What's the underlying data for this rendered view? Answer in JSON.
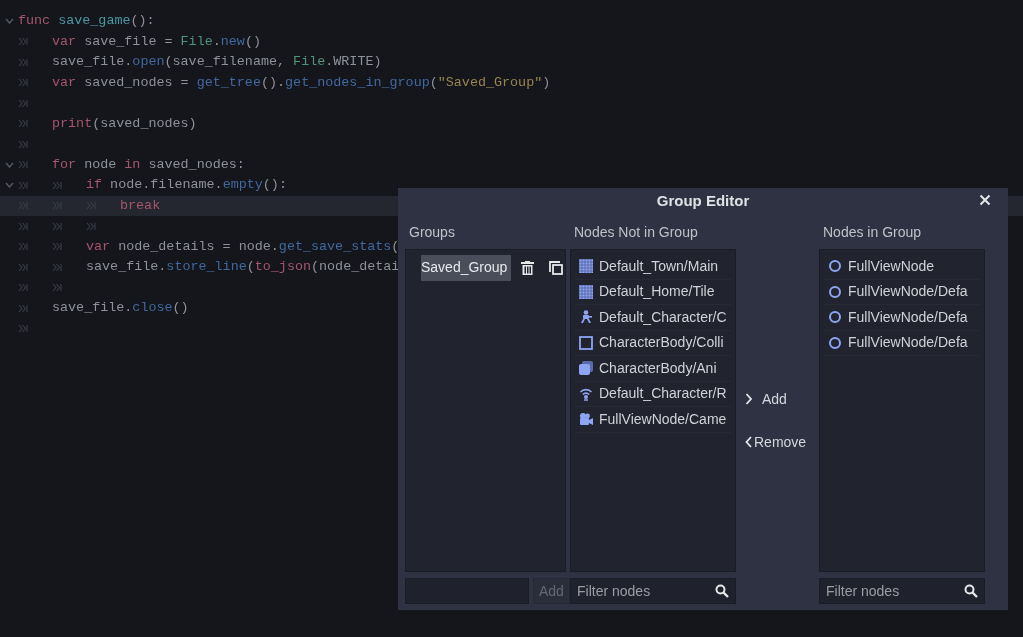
{
  "code_editor": {
    "lines": [
      {
        "foldable": true,
        "current": false,
        "tokens": [
          {
            "kind": "keyword",
            "text": "func"
          },
          {
            "kind": "name",
            "text": " save_game"
          },
          {
            "kind": "plain",
            "text": "():"
          }
        ],
        "children": [
          {
            "foldable": false,
            "current": false,
            "tokens": [
              {
                "kind": "keyword",
                "text": "var"
              },
              {
                "kind": "plain",
                "text": " save_file = "
              },
              {
                "kind": "class",
                "text": "File"
              },
              {
                "kind": "plain",
                "text": "."
              },
              {
                "kind": "method",
                "text": "new"
              },
              {
                "kind": "plain",
                "text": "()"
              }
            ]
          },
          {
            "foldable": false,
            "current": false,
            "tokens": [
              {
                "kind": "plain",
                "text": "save_file."
              },
              {
                "kind": "method",
                "text": "open"
              },
              {
                "kind": "plain",
                "text": "(save_filename, "
              },
              {
                "kind": "class",
                "text": "File"
              },
              {
                "kind": "plain",
                "text": ".WRITE)"
              }
            ]
          },
          {
            "foldable": false,
            "current": false,
            "tokens": [
              {
                "kind": "keyword",
                "text": "var"
              },
              {
                "kind": "plain",
                "text": " saved_nodes = "
              },
              {
                "kind": "method",
                "text": "get_tree"
              },
              {
                "kind": "plain",
                "text": "()."
              },
              {
                "kind": "method",
                "text": "get_nodes_in_group"
              },
              {
                "kind": "plain",
                "text": "("
              },
              {
                "kind": "string",
                "text": "\"Saved_Group\""
              },
              {
                "kind": "plain",
                "text": ")"
              }
            ]
          },
          {
            "foldable": false,
            "current": false
          },
          {
            "foldable": false,
            "current": false,
            "tokens": [
              {
                "kind": "keyword",
                "text": "print"
              },
              {
                "kind": "plain",
                "text": "(saved_nodes)"
              }
            ]
          },
          {
            "foldable": false,
            "current": false
          },
          {
            "foldable": true,
            "current": false,
            "tokens": [
              {
                "kind": "keyword",
                "text": "for"
              },
              {
                "kind": "plain",
                "text": " node "
              },
              {
                "kind": "keyword",
                "text": "in"
              },
              {
                "kind": "plain",
                "text": " saved_nodes:"
              }
            ],
            "children": [
              {
                "foldable": true,
                "current": false,
                "tokens": [
                  {
                    "kind": "keyword",
                    "text": "if"
                  },
                  {
                    "kind": "plain",
                    "text": " node.filename."
                  },
                  {
                    "kind": "method",
                    "text": "empty"
                  },
                  {
                    "kind": "plain",
                    "text": "():"
                  }
                ],
                "children": [
                  {
                    "foldable": false,
                    "current": true,
                    "tokens": [
                      {
                        "kind": "keyword",
                        "text": "break"
                      }
                    ]
                  },
                  {
                    "foldable": false,
                    "current": false
                  }
                ]
              },
              {
                "foldable": false,
                "current": false,
                "tokens": [
                  {
                    "kind": "keyword",
                    "text": "var"
                  },
                  {
                    "kind": "plain",
                    "text": " node_details = node."
                  },
                  {
                    "kind": "method",
                    "text": "get_save_stats"
                  },
                  {
                    "kind": "plain",
                    "text": "("
                  }
                ]
              },
              {
                "foldable": false,
                "current": false,
                "tokens": [
                  {
                    "kind": "plain",
                    "text": "save_file."
                  },
                  {
                    "kind": "method",
                    "text": "store_line"
                  },
                  {
                    "kind": "plain",
                    "text": "("
                  },
                  {
                    "kind": "keyword",
                    "text": "to_json"
                  },
                  {
                    "kind": "plain",
                    "text": "(node_detai"
                  }
                ]
              },
              {
                "foldable": false,
                "current": false
              }
            ]
          },
          {
            "foldable": false,
            "current": false,
            "tokens": [
              {
                "kind": "plain",
                "text": "save_file."
              },
              {
                "kind": "method",
                "text": "close"
              },
              {
                "kind": "plain",
                "text": "()"
              }
            ]
          },
          {
            "foldable": false,
            "current": false
          }
        ]
      }
    ]
  },
  "dialog": {
    "title": "Group Editor",
    "groups": {
      "label": "Groups",
      "items": [
        {
          "name": "Saved_Group",
          "selected": true
        }
      ],
      "add_button": {
        "label": "Add",
        "disabled": true
      }
    },
    "nodes_not_in_group": {
      "label": "Nodes Not in Group",
      "items": [
        {
          "kind": "tilemap",
          "text": "Default_Town/Main"
        },
        {
          "kind": "tilemap",
          "text": "Default_Home/Tile"
        },
        {
          "kind": "character",
          "text": "Default_Character/C"
        },
        {
          "kind": "collision",
          "text": "CharacterBody/Colli"
        },
        {
          "kind": "sprite",
          "text": "CharacterBody/Ani"
        },
        {
          "kind": "signal",
          "text": "Default_Character/R"
        },
        {
          "kind": "camera",
          "text": "FullViewNode/Came"
        }
      ],
      "filter": {
        "placeholder": "Filter nodes"
      }
    },
    "actions": [
      {
        "kind": "add",
        "label": "Add"
      },
      {
        "kind": "remove",
        "label": "Remove"
      }
    ],
    "nodes_in_group": {
      "label": "Nodes in Group",
      "items": [
        {
          "kind": "node",
          "text": "FullViewNode"
        },
        {
          "kind": "node",
          "text": "FullViewNode/Defa"
        },
        {
          "kind": "node",
          "text": "FullViewNode/Defa"
        },
        {
          "kind": "node",
          "text": "FullViewNode/Defa"
        }
      ],
      "filter": {
        "placeholder": "Filter nodes"
      }
    }
  }
}
